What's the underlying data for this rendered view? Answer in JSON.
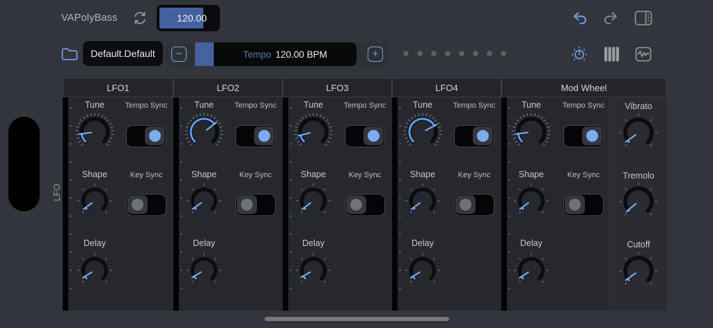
{
  "top_bar": {
    "app_title": "VAPolyBass",
    "tempo_field_value": "120.00",
    "icons": [
      "sync-icon",
      "undo-icon",
      "redo-icon",
      "layout-panel-icon"
    ]
  },
  "preset_bar": {
    "preset_name": "Default.Default",
    "minus_label": "−",
    "plus_label": "+",
    "tempo_label": "Tempo",
    "tempo_value": "120.00 BPM",
    "page_dots": 8,
    "icons": [
      "folder-icon",
      "dial-icon",
      "piano-icon",
      "waveform-icon"
    ]
  },
  "side": {
    "group_label": "LFO"
  },
  "panels": [
    {
      "title": "LFO1",
      "knobs": [
        {
          "id": "tune",
          "label": "Tune",
          "angle": -98,
          "style": "fine"
        },
        {
          "id": "shape",
          "label": "Shape",
          "angle": -127,
          "style": "coarse"
        },
        {
          "id": "delay",
          "label": "Delay",
          "angle": -122,
          "style": "coarse"
        }
      ],
      "toggles": [
        {
          "id": "tempo_sync",
          "label": "Tempo Sync",
          "on": true
        },
        {
          "id": "key_sync",
          "label": "Key Sync",
          "on": false
        }
      ]
    },
    {
      "title": "LFO2",
      "knobs": [
        {
          "id": "tune",
          "label": "Tune",
          "angle": 52,
          "style": "fine"
        },
        {
          "id": "shape",
          "label": "Shape",
          "angle": -126,
          "style": "coarse"
        },
        {
          "id": "delay",
          "label": "Delay",
          "angle": -121,
          "style": "coarse"
        }
      ],
      "toggles": [
        {
          "id": "tempo_sync",
          "label": "Tempo Sync",
          "on": true
        },
        {
          "id": "key_sync",
          "label": "Key Sync",
          "on": false
        }
      ]
    },
    {
      "title": "LFO3",
      "knobs": [
        {
          "id": "tune",
          "label": "Tune",
          "angle": -104,
          "style": "fine"
        },
        {
          "id": "shape",
          "label": "Shape",
          "angle": -127,
          "style": "coarse"
        },
        {
          "id": "delay",
          "label": "Delay",
          "angle": -120,
          "style": "coarse"
        }
      ],
      "toggles": [
        {
          "id": "tempo_sync",
          "label": "Tempo Sync",
          "on": true
        },
        {
          "id": "key_sync",
          "label": "Key Sync",
          "on": false
        }
      ]
    },
    {
      "title": "LFO4",
      "knobs": [
        {
          "id": "tune",
          "label": "Tune",
          "angle": 62,
          "style": "fine"
        },
        {
          "id": "shape",
          "label": "Shape",
          "angle": -127,
          "style": "coarse"
        },
        {
          "id": "delay",
          "label": "Delay",
          "angle": -122,
          "style": "coarse"
        }
      ],
      "toggles": [
        {
          "id": "tempo_sync",
          "label": "Tempo Sync",
          "on": true
        },
        {
          "id": "key_sync",
          "label": "Key Sync",
          "on": false
        }
      ]
    },
    {
      "title": "Mod Wheel",
      "knobs": [
        {
          "id": "tune",
          "label": "Tune",
          "angle": -97,
          "style": "fine"
        },
        {
          "id": "shape",
          "label": "Shape",
          "angle": -126,
          "style": "coarse"
        },
        {
          "id": "delay",
          "label": "Delay",
          "angle": -123,
          "style": "coarse"
        }
      ],
      "toggles": [
        {
          "id": "tempo_sync",
          "label": "Tempo Sync",
          "on": true
        },
        {
          "id": "key_sync",
          "label": "Key Sync",
          "on": false
        }
      ],
      "extra_knobs": [
        {
          "id": "vibrato",
          "label": "Vibrato",
          "angle": -126,
          "style": "big"
        },
        {
          "id": "tremolo",
          "label": "Tremolo",
          "angle": -130,
          "style": "big"
        },
        {
          "id": "cutoff",
          "label": "Cutoff",
          "angle": -126,
          "style": "big"
        }
      ]
    }
  ],
  "colors": {
    "accent_blue": "#74A6F0",
    "selection_blue": "#44619F",
    "knob_arc_blue": "#5E9BF5",
    "toggle_on_blue": "#7CACF0",
    "panel_bg": "#26282D",
    "background": "#32353B"
  }
}
